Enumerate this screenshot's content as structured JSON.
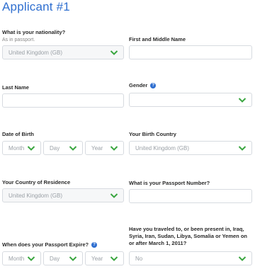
{
  "form": {
    "title": "Applicant #1",
    "nationality": {
      "label": "What is your nationality?",
      "hint": "As in passport.",
      "value": "United Kingdom (GB)"
    },
    "first_middle_name": {
      "label": "First and Middle Name",
      "value": ""
    },
    "last_name": {
      "label": "Last Name",
      "value": ""
    },
    "gender": {
      "label": "Gender",
      "help": "?",
      "value": ""
    },
    "date_of_birth": {
      "label": "Date of Birth",
      "month": "Month",
      "day": "Day",
      "year": "Year"
    },
    "birth_country": {
      "label": "Your Birth Country",
      "value": "United Kingdom (GB)"
    },
    "country_of_residence": {
      "label": "Your Country of Residence",
      "value": "United Kingdom (GB)"
    },
    "passport_number": {
      "label": "What is your Passport Number?",
      "value": ""
    },
    "passport_expire": {
      "label": "When does your Passport Expire?",
      "help": "?",
      "month": "Month",
      "day": "Day",
      "year": "Year"
    },
    "travel_history": {
      "label": "Have you traveled to, or been present in, Iraq, Syria, Iran, Sudan, Libya, Somalia or Yemen on or after March 1, 2011?",
      "value": "No"
    }
  },
  "colors": {
    "accent": "#2f6fd0",
    "chevron": "#3aa640",
    "border": "#d7dbe0"
  }
}
